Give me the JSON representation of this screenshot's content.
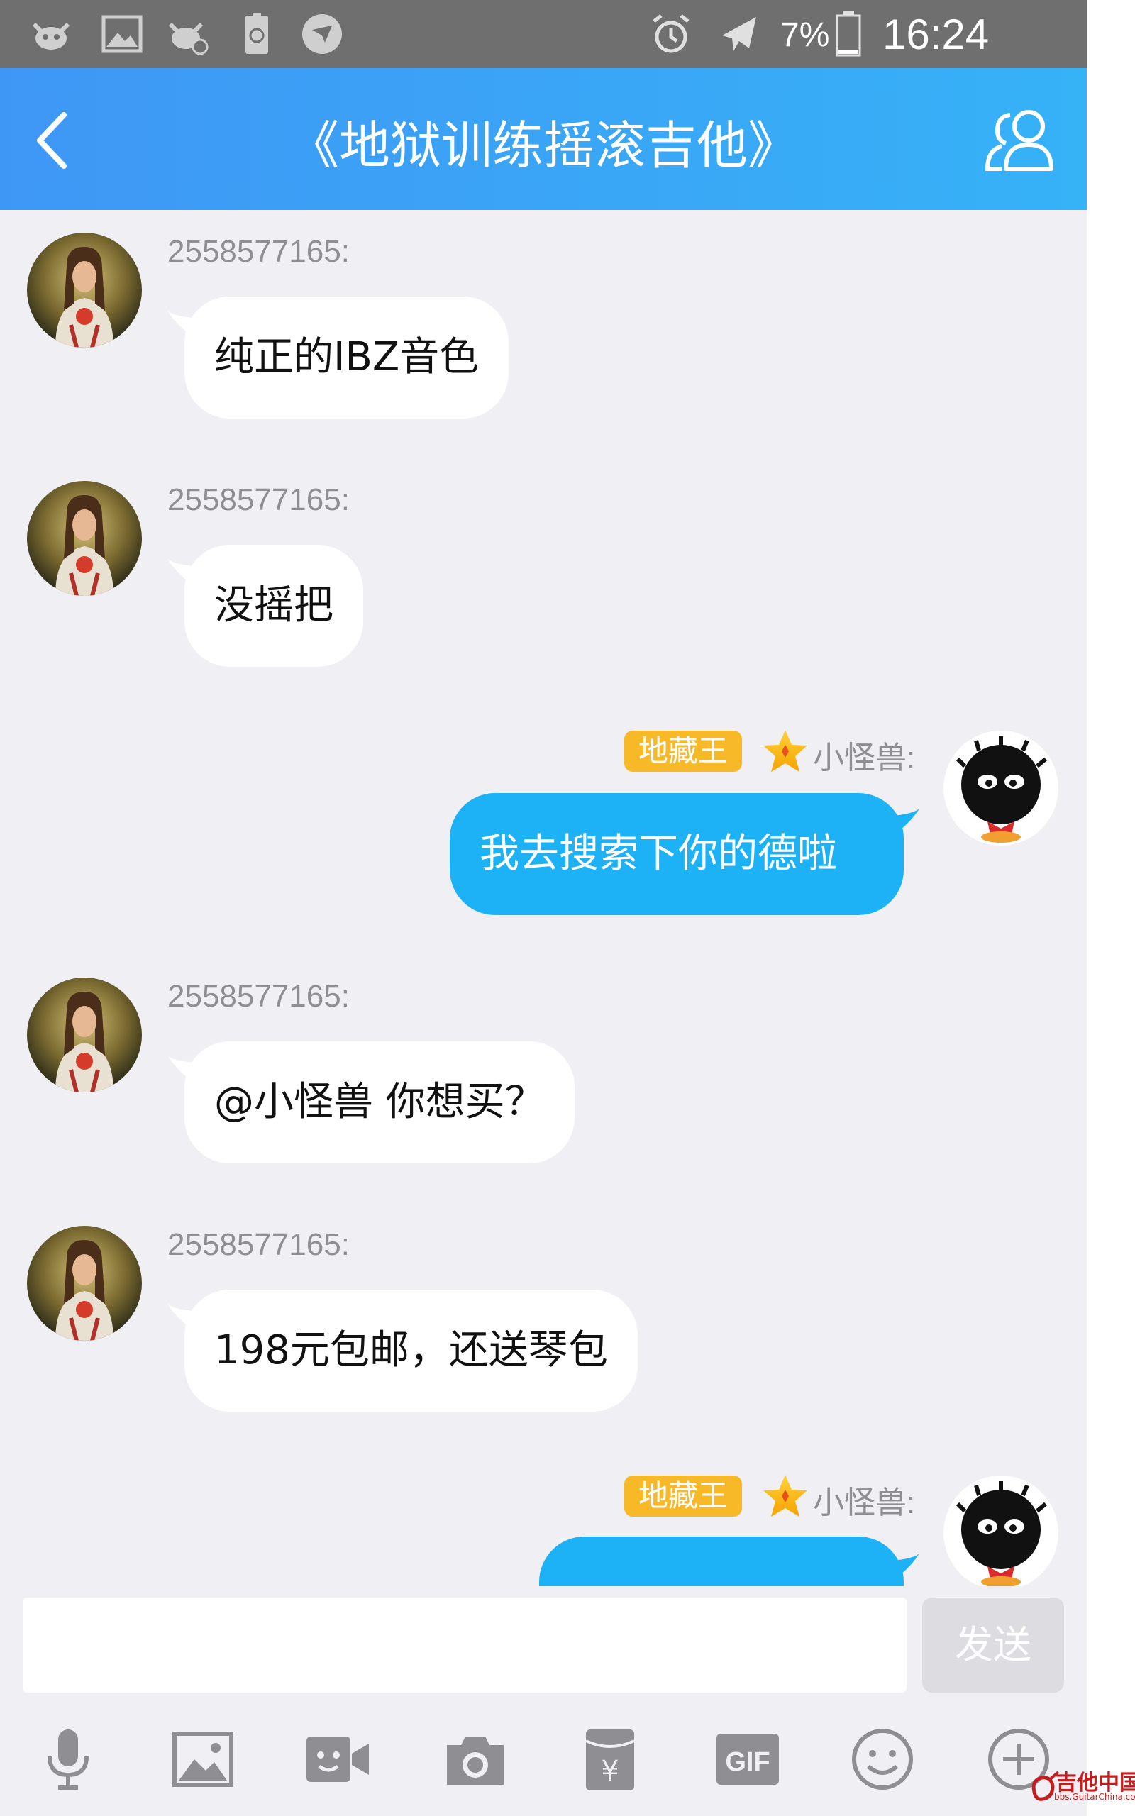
{
  "status_bar": {
    "battery_percent": "7%",
    "time": "16:24",
    "icons": [
      "cow-app-icon",
      "gallery-icon",
      "cow-app-muted-icon",
      "recycle-battery-icon",
      "bird-app-icon",
      "alarm-icon",
      "airplane-mode-icon",
      "battery-icon"
    ]
  },
  "header": {
    "title": "《地狱训练摇滚吉他》",
    "back_icon": "chevron-left-icon",
    "members_icon": "group-members-icon"
  },
  "messages": [
    {
      "side": "left",
      "sender": "2558577165:",
      "text": "纯正的IBZ音色"
    },
    {
      "side": "left",
      "sender": "2558577165:",
      "text": "没摇把"
    },
    {
      "side": "right",
      "badge": "地藏王",
      "sender": "小怪兽:",
      "text": "我去搜索下你的德啦"
    },
    {
      "side": "left",
      "sender": "2558577165:",
      "text": "@小怪兽 你想买？"
    },
    {
      "side": "left",
      "sender": "2558577165:",
      "text": "198元包邮，还送琴包"
    },
    {
      "side": "right",
      "badge": "地藏王",
      "sender": "小怪兽:",
      "text": ""
    }
  ],
  "composer": {
    "input_value": "",
    "send_label": "发送"
  },
  "toolbar": {
    "items": [
      "microphone-icon",
      "image-icon",
      "video-chat-icon",
      "camera-icon",
      "red-packet-icon",
      "gif-icon",
      "emoji-icon",
      "plus-icon"
    ],
    "gif_label": "GIF",
    "currency_symbol": "¥"
  },
  "watermark": {
    "text": "吉他中国",
    "subtext": "bbs.GuitarChina.com"
  },
  "colors": {
    "header_gradient_start": "#3f97f5",
    "header_gradient_end": "#36b2f7",
    "right_bubble": "#1cb2f5",
    "badge": "#f7b928",
    "chat_background": "#efeff4"
  }
}
